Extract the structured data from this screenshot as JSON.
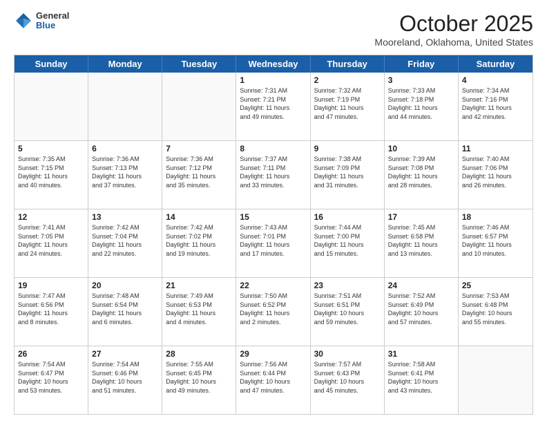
{
  "header": {
    "logo": {
      "general": "General",
      "blue": "Blue"
    },
    "title": "October 2025",
    "subtitle": "Mooreland, Oklahoma, United States"
  },
  "days_of_week": [
    "Sunday",
    "Monday",
    "Tuesday",
    "Wednesday",
    "Thursday",
    "Friday",
    "Saturday"
  ],
  "weeks": [
    [
      {
        "day": "",
        "info": ""
      },
      {
        "day": "",
        "info": ""
      },
      {
        "day": "",
        "info": ""
      },
      {
        "day": "1",
        "info": "Sunrise: 7:31 AM\nSunset: 7:21 PM\nDaylight: 11 hours\nand 49 minutes."
      },
      {
        "day": "2",
        "info": "Sunrise: 7:32 AM\nSunset: 7:19 PM\nDaylight: 11 hours\nand 47 minutes."
      },
      {
        "day": "3",
        "info": "Sunrise: 7:33 AM\nSunset: 7:18 PM\nDaylight: 11 hours\nand 44 minutes."
      },
      {
        "day": "4",
        "info": "Sunrise: 7:34 AM\nSunset: 7:16 PM\nDaylight: 11 hours\nand 42 minutes."
      }
    ],
    [
      {
        "day": "5",
        "info": "Sunrise: 7:35 AM\nSunset: 7:15 PM\nDaylight: 11 hours\nand 40 minutes."
      },
      {
        "day": "6",
        "info": "Sunrise: 7:36 AM\nSunset: 7:13 PM\nDaylight: 11 hours\nand 37 minutes."
      },
      {
        "day": "7",
        "info": "Sunrise: 7:36 AM\nSunset: 7:12 PM\nDaylight: 11 hours\nand 35 minutes."
      },
      {
        "day": "8",
        "info": "Sunrise: 7:37 AM\nSunset: 7:11 PM\nDaylight: 11 hours\nand 33 minutes."
      },
      {
        "day": "9",
        "info": "Sunrise: 7:38 AM\nSunset: 7:09 PM\nDaylight: 11 hours\nand 31 minutes."
      },
      {
        "day": "10",
        "info": "Sunrise: 7:39 AM\nSunset: 7:08 PM\nDaylight: 11 hours\nand 28 minutes."
      },
      {
        "day": "11",
        "info": "Sunrise: 7:40 AM\nSunset: 7:06 PM\nDaylight: 11 hours\nand 26 minutes."
      }
    ],
    [
      {
        "day": "12",
        "info": "Sunrise: 7:41 AM\nSunset: 7:05 PM\nDaylight: 11 hours\nand 24 minutes."
      },
      {
        "day": "13",
        "info": "Sunrise: 7:42 AM\nSunset: 7:04 PM\nDaylight: 11 hours\nand 22 minutes."
      },
      {
        "day": "14",
        "info": "Sunrise: 7:42 AM\nSunset: 7:02 PM\nDaylight: 11 hours\nand 19 minutes."
      },
      {
        "day": "15",
        "info": "Sunrise: 7:43 AM\nSunset: 7:01 PM\nDaylight: 11 hours\nand 17 minutes."
      },
      {
        "day": "16",
        "info": "Sunrise: 7:44 AM\nSunset: 7:00 PM\nDaylight: 11 hours\nand 15 minutes."
      },
      {
        "day": "17",
        "info": "Sunrise: 7:45 AM\nSunset: 6:58 PM\nDaylight: 11 hours\nand 13 minutes."
      },
      {
        "day": "18",
        "info": "Sunrise: 7:46 AM\nSunset: 6:57 PM\nDaylight: 11 hours\nand 10 minutes."
      }
    ],
    [
      {
        "day": "19",
        "info": "Sunrise: 7:47 AM\nSunset: 6:56 PM\nDaylight: 11 hours\nand 8 minutes."
      },
      {
        "day": "20",
        "info": "Sunrise: 7:48 AM\nSunset: 6:54 PM\nDaylight: 11 hours\nand 6 minutes."
      },
      {
        "day": "21",
        "info": "Sunrise: 7:49 AM\nSunset: 6:53 PM\nDaylight: 11 hours\nand 4 minutes."
      },
      {
        "day": "22",
        "info": "Sunrise: 7:50 AM\nSunset: 6:52 PM\nDaylight: 11 hours\nand 2 minutes."
      },
      {
        "day": "23",
        "info": "Sunrise: 7:51 AM\nSunset: 6:51 PM\nDaylight: 10 hours\nand 59 minutes."
      },
      {
        "day": "24",
        "info": "Sunrise: 7:52 AM\nSunset: 6:49 PM\nDaylight: 10 hours\nand 57 minutes."
      },
      {
        "day": "25",
        "info": "Sunrise: 7:53 AM\nSunset: 6:48 PM\nDaylight: 10 hours\nand 55 minutes."
      }
    ],
    [
      {
        "day": "26",
        "info": "Sunrise: 7:54 AM\nSunset: 6:47 PM\nDaylight: 10 hours\nand 53 minutes."
      },
      {
        "day": "27",
        "info": "Sunrise: 7:54 AM\nSunset: 6:46 PM\nDaylight: 10 hours\nand 51 minutes."
      },
      {
        "day": "28",
        "info": "Sunrise: 7:55 AM\nSunset: 6:45 PM\nDaylight: 10 hours\nand 49 minutes."
      },
      {
        "day": "29",
        "info": "Sunrise: 7:56 AM\nSunset: 6:44 PM\nDaylight: 10 hours\nand 47 minutes."
      },
      {
        "day": "30",
        "info": "Sunrise: 7:57 AM\nSunset: 6:43 PM\nDaylight: 10 hours\nand 45 minutes."
      },
      {
        "day": "31",
        "info": "Sunrise: 7:58 AM\nSunset: 6:41 PM\nDaylight: 10 hours\nand 43 minutes."
      },
      {
        "day": "",
        "info": ""
      }
    ]
  ]
}
